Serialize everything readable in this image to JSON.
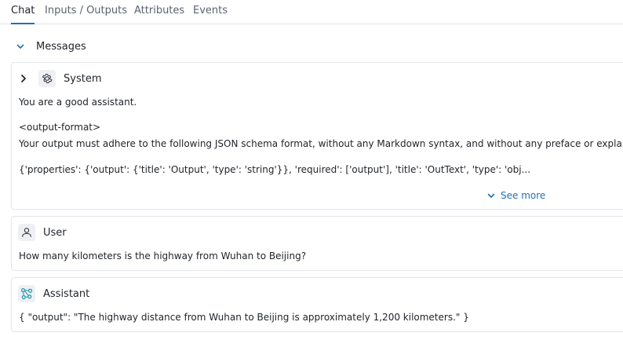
{
  "tabs": [
    {
      "label": "Chat",
      "active": true
    },
    {
      "label": "Inputs / Outputs",
      "active": false
    },
    {
      "label": "Attributes",
      "active": false
    },
    {
      "label": "Events",
      "active": false
    }
  ],
  "messages_section": {
    "title": "Messages",
    "icon": "chevron-down-icon"
  },
  "system_message": {
    "role": "System",
    "icon": "gear-icon",
    "toggle_icon": "chevron-right-icon",
    "lines": [
      "You are a good assistant.",
      "<output-format>",
      "Your output must adhere to the following JSON schema format, without any Markdown syntax, and without any preface or explanation",
      "{'properties': {'output': {'title': 'Output', 'type': 'string'}}, 'required': ['output'], 'title': 'OutText', 'type': 'obj..."
    ],
    "see_more_label": "See more"
  },
  "user_message": {
    "role": "User",
    "icon": "person-icon",
    "text": "How many kilometers is the highway from Wuhan to Beijing?"
  },
  "assistant_message": {
    "role": "Assistant",
    "icon": "assistant-network-icon",
    "text": "{ \"output\": \"The highway distance from Wuhan to Beijing is approximately 1,200 kilometers.\" }"
  },
  "colors": {
    "accent": "#1f6fb5",
    "assistant_icon": "#2b9fb0",
    "border": "#e3e6ea"
  }
}
